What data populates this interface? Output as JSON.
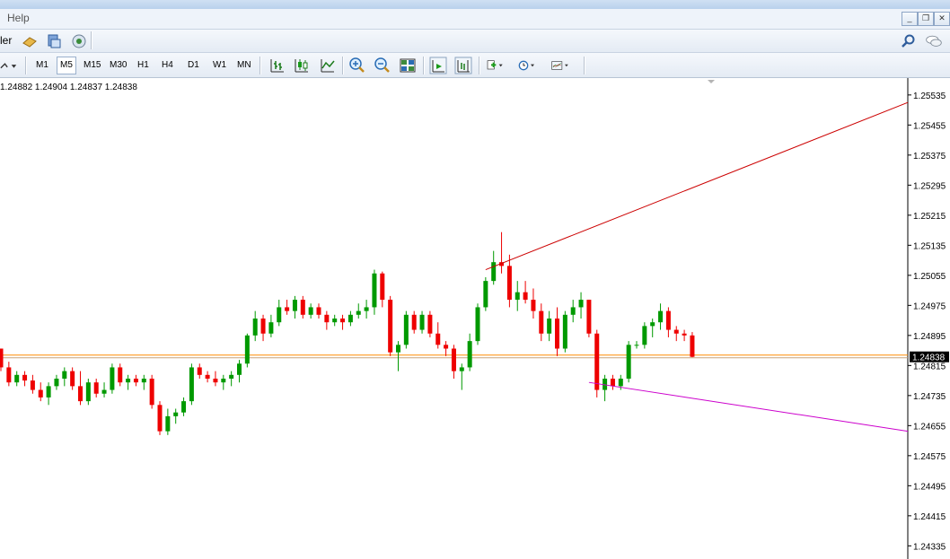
{
  "menu": {
    "help": "Help"
  },
  "toolbar": {
    "partial_label": "ler",
    "timeframes": [
      "M1",
      "M5",
      "M15",
      "M30",
      "H1",
      "H4",
      "D1",
      "W1",
      "MN"
    ],
    "active_timeframe": "M5"
  },
  "chart": {
    "ohlc_text": "1.24882 1.24904 1.24837 1.24838",
    "price_ticks": [
      "1.25535",
      "1.25455",
      "1.25375",
      "1.25295",
      "1.25215",
      "1.25135",
      "1.25055",
      "1.24975",
      "1.24895",
      "1.24815",
      "1.24735",
      "1.24655",
      "1.24575",
      "1.24495",
      "1.24415",
      "1.24335"
    ],
    "current_price": "1.24838"
  },
  "chart_data": {
    "type": "candlestick",
    "y_range": [
      1.243,
      1.2558
    ],
    "current_price": 1.24838,
    "bull_color": "#009900",
    "bear_color": "#ee0000",
    "candles": [
      [
        1.2486,
        1.2486,
        1.248,
        1.2481
      ],
      [
        1.2481,
        1.24825,
        1.2476,
        1.2477
      ],
      [
        1.2477,
        1.248,
        1.2476,
        1.2479
      ],
      [
        1.2479,
        1.248,
        1.2476,
        1.24775
      ],
      [
        1.24775,
        1.2479,
        1.2474,
        1.2475
      ],
      [
        1.2475,
        1.2477,
        1.2472,
        1.2473
      ],
      [
        1.2473,
        1.2477,
        1.2471,
        1.2476
      ],
      [
        1.2476,
        1.2479,
        1.2475,
        1.2478
      ],
      [
        1.2478,
        1.2481,
        1.2476,
        1.248
      ],
      [
        1.248,
        1.2481,
        1.2475,
        1.2476
      ],
      [
        1.2476,
        1.248,
        1.2471,
        1.2472
      ],
      [
        1.2472,
        1.2478,
        1.2471,
        1.2477
      ],
      [
        1.2477,
        1.2478,
        1.2473,
        1.2474
      ],
      [
        1.2474,
        1.2477,
        1.2473,
        1.2475
      ],
      [
        1.2475,
        1.2482,
        1.2474,
        1.2481
      ],
      [
        1.2481,
        1.2482,
        1.2476,
        1.2477
      ],
      [
        1.2477,
        1.2479,
        1.2475,
        1.2478
      ],
      [
        1.2478,
        1.2479,
        1.2476,
        1.2477
      ],
      [
        1.2477,
        1.2479,
        1.2475,
        1.2478
      ],
      [
        1.2478,
        1.2479,
        1.247,
        1.2471
      ],
      [
        1.2471,
        1.2472,
        1.2463,
        1.2464
      ],
      [
        1.2464,
        1.247,
        1.2463,
        1.2468
      ],
      [
        1.2468,
        1.247,
        1.2466,
        1.2469
      ],
      [
        1.2469,
        1.2473,
        1.2468,
        1.2472
      ],
      [
        1.2472,
        1.2482,
        1.2471,
        1.2481
      ],
      [
        1.2481,
        1.2482,
        1.2478,
        1.2479
      ],
      [
        1.2479,
        1.248,
        1.2477,
        1.2478
      ],
      [
        1.2478,
        1.248,
        1.2476,
        1.2477
      ],
      [
        1.2477,
        1.2479,
        1.2475,
        1.2478
      ],
      [
        1.2478,
        1.248,
        1.2476,
        1.2479
      ],
      [
        1.2479,
        1.2483,
        1.2477,
        1.2482
      ],
      [
        1.2482,
        1.249,
        1.2481,
        1.24895
      ],
      [
        1.24895,
        1.2496,
        1.2488,
        1.2494
      ],
      [
        1.2494,
        1.2495,
        1.2488,
        1.249
      ],
      [
        1.249,
        1.2495,
        1.2489,
        1.2493
      ],
      [
        1.2493,
        1.2499,
        1.2492,
        1.2497
      ],
      [
        1.2497,
        1.2499,
        1.2495,
        1.2496
      ],
      [
        1.2496,
        1.25,
        1.2494,
        1.2499
      ],
      [
        1.2499,
        1.25,
        1.2494,
        1.2495
      ],
      [
        1.2495,
        1.2498,
        1.2494,
        1.2497
      ],
      [
        1.2497,
        1.2498,
        1.2494,
        1.2495
      ],
      [
        1.2495,
        1.2496,
        1.2491,
        1.2493
      ],
      [
        1.2493,
        1.2495,
        1.2492,
        1.2494
      ],
      [
        1.2494,
        1.2495,
        1.2491,
        1.2493
      ],
      [
        1.2493,
        1.2496,
        1.2492,
        1.2495
      ],
      [
        1.2495,
        1.2498,
        1.2494,
        1.2496
      ],
      [
        1.2496,
        1.2499,
        1.2494,
        1.2497
      ],
      [
        1.2497,
        1.2507,
        1.2495,
        1.2506
      ],
      [
        1.2506,
        1.25065,
        1.2497,
        1.2499
      ],
      [
        1.2499,
        1.25,
        1.2484,
        1.2485
      ],
      [
        1.2485,
        1.2488,
        1.248,
        1.2487
      ],
      [
        1.2487,
        1.2496,
        1.2486,
        1.2495
      ],
      [
        1.2495,
        1.2496,
        1.249,
        1.2491
      ],
      [
        1.2491,
        1.2496,
        1.249,
        1.2495
      ],
      [
        1.2495,
        1.2496,
        1.2489,
        1.249
      ],
      [
        1.249,
        1.2493,
        1.2486,
        1.2487
      ],
      [
        1.2487,
        1.2488,
        1.2484,
        1.2486
      ],
      [
        1.2486,
        1.2487,
        1.2478,
        1.248
      ],
      [
        1.248,
        1.2482,
        1.2475,
        1.2481
      ],
      [
        1.2481,
        1.249,
        1.248,
        1.2488
      ],
      [
        1.2488,
        1.2498,
        1.2487,
        1.2497
      ],
      [
        1.2497,
        1.2505,
        1.2496,
        1.2504
      ],
      [
        1.2504,
        1.2512,
        1.2503,
        1.2509
      ],
      [
        1.2509,
        1.2517,
        1.2506,
        1.2508
      ],
      [
        1.2508,
        1.2511,
        1.2497,
        1.2499
      ],
      [
        1.2499,
        1.2504,
        1.2496,
        1.2501
      ],
      [
        1.2501,
        1.2504,
        1.2498,
        1.2499
      ],
      [
        1.2499,
        1.2502,
        1.2494,
        1.2496
      ],
      [
        1.2496,
        1.2498,
        1.2488,
        1.249
      ],
      [
        1.249,
        1.2496,
        1.2488,
        1.2494
      ],
      [
        1.2494,
        1.2497,
        1.2484,
        1.2486
      ],
      [
        1.2486,
        1.2496,
        1.2485,
        1.2495
      ],
      [
        1.2495,
        1.2499,
        1.2493,
        1.2497
      ],
      [
        1.2497,
        1.2501,
        1.2494,
        1.2499
      ],
      [
        1.2499,
        1.2499,
        1.2489,
        1.249
      ],
      [
        1.249,
        1.2491,
        1.2473,
        1.2475
      ],
      [
        1.2475,
        1.2479,
        1.2472,
        1.2478
      ],
      [
        1.2478,
        1.2479,
        1.2475,
        1.2476
      ],
      [
        1.2476,
        1.2479,
        1.2475,
        1.2478
      ],
      [
        1.2478,
        1.2488,
        1.2477,
        1.2487
      ],
      [
        1.2487,
        1.2488,
        1.2486,
        1.2487
      ],
      [
        1.2487,
        1.2493,
        1.2486,
        1.2492
      ],
      [
        1.2492,
        1.2494,
        1.2489,
        1.2493
      ],
      [
        1.2493,
        1.2498,
        1.2491,
        1.2496
      ],
      [
        1.2496,
        1.2497,
        1.2489,
        1.2491
      ],
      [
        1.2491,
        1.2492,
        1.2488,
        1.249
      ],
      [
        1.249,
        1.2491,
        1.2488,
        1.24895
      ],
      [
        1.24895,
        1.24904,
        1.24837,
        1.24838
      ]
    ],
    "trendlines": [
      {
        "color": "#cc0000",
        "from": [
          61,
          1.2507
        ],
        "to": [
          "right-edge",
          1.25515
        ]
      },
      {
        "color": "#cc00cc",
        "from": [
          74,
          1.2477
        ],
        "to": [
          "right-edge",
          1.2464
        ]
      }
    ]
  },
  "colors": {
    "price_line": "#ff8c00",
    "axis_line": "#000000",
    "price_tag_bg": "#000000",
    "price_tag_fg": "#ffffff"
  }
}
